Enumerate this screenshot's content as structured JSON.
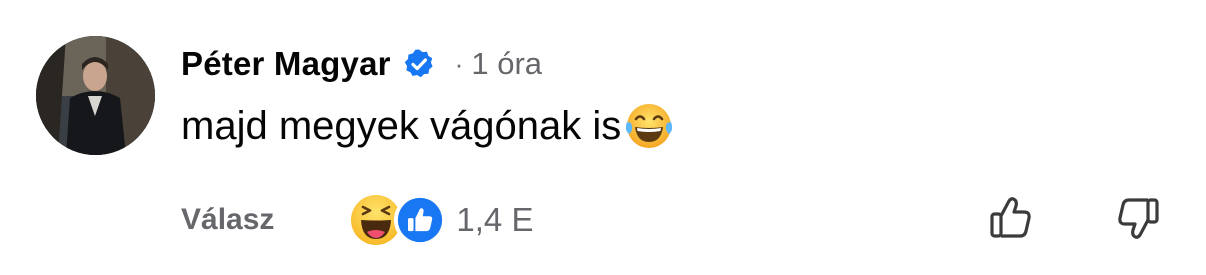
{
  "comment": {
    "author": "Péter Magyar",
    "time_separator": "·",
    "time": "1 óra",
    "text": "majd megyek vágónak is",
    "reply_label": "Válasz",
    "reaction_count": "1,4 E",
    "icons": {
      "verified": "verified-badge-icon",
      "text_emoji": "face-with-tears-of-joy-icon",
      "reactions": [
        "haha-reaction-icon",
        "like-reaction-icon"
      ],
      "vote_up": "thumbs-up-outline-icon",
      "vote_down": "thumbs-down-outline-icon"
    },
    "colors": {
      "author_text": "#050505",
      "secondary_text": "#65676b",
      "verified_blue": "#1877f2",
      "like_blue": "#1877f2",
      "haha_yellow": "#f7b928"
    }
  }
}
